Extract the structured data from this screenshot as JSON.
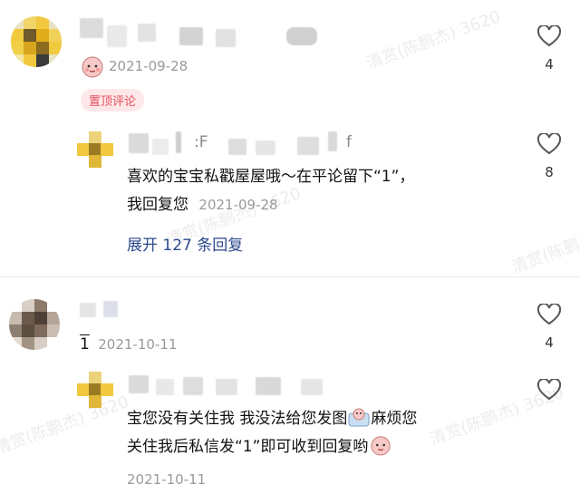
{
  "comments": [
    {
      "date": "2021-09-28",
      "likes": "4",
      "pin_label": "置顶评论",
      "reply": {
        "blurred_name_fragment": ":F",
        "blurred_name_tail": "f",
        "likes": "8",
        "text_line1": "喜欢的宝宝私戳屋屋哦～在平论留下“1”，",
        "text_line2": "我回复您",
        "date": "2021-09-28",
        "expand_label": "展开 127 条回复"
      }
    },
    {
      "text": "1",
      "date": "2021-10-11",
      "likes": "4",
      "reply": {
        "text_line1": "宝您没有关住我 我没法给您发图",
        "text_line1_tail": "麻烦您",
        "text_line2": "关住我后私信发“1”即可收到回复哟",
        "date": "2021-10-11",
        "likes_label": ""
      }
    }
  ],
  "watermark": "清赏(陈鹏杰) 3620",
  "colors": {
    "pin_bg": "#fde7e8",
    "pin_fg": "#e6505f",
    "expand": "#2c4a8d",
    "heart": "#555555"
  },
  "icons": [
    "heart-icon",
    "sticker-emoji-icon",
    "avatar-mosaic"
  ]
}
